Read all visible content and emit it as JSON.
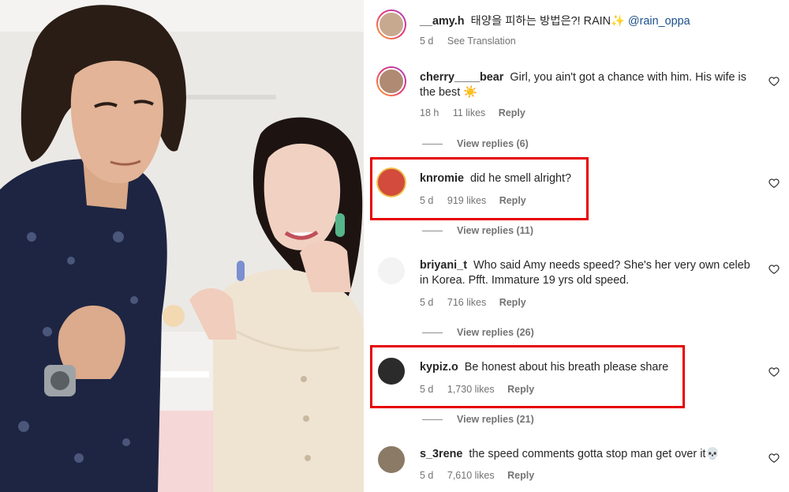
{
  "comments": [
    {
      "username": "__amy.h",
      "text": "태양을 피하는 방법은?! RAIN✨",
      "mention": "@rain_oppa",
      "time": "5 d",
      "action": "See Translation",
      "likes": "",
      "reply": ""
    },
    {
      "username": "cherry____bear",
      "text": "Girl, you ain't got a chance with him. His wife is the best ☀️",
      "time": "18 h",
      "likes": "11 likes",
      "reply": "Reply",
      "view_replies": "View replies (6)"
    },
    {
      "username": "knromie",
      "text": "did he smell alright?",
      "time": "5 d",
      "likes": "919 likes",
      "reply": "Reply",
      "view_replies": "View replies (11)"
    },
    {
      "username": "briyani_t",
      "text": "Who said Amy needs speed? She's her very own celeb in Korea. Pfft. Immature 19 yrs old speed.",
      "time": "5 d",
      "likes": "716 likes",
      "reply": "Reply",
      "view_replies": "View replies (26)"
    },
    {
      "username": "kypiz.o",
      "text": "Be honest about his breath please share",
      "time": "5 d",
      "likes": "1,730 likes",
      "reply": "Reply",
      "view_replies": "View replies (21)"
    },
    {
      "username": "s_3rene",
      "text": "the speed comments gotta stop man get over it💀",
      "time": "5 d",
      "likes": "7,610 likes",
      "reply": "Reply"
    }
  ],
  "colors": {
    "highlight": "#e60000",
    "mention": "#1a4f8b",
    "meta": "#737373",
    "story_ring": "#e8336d"
  },
  "icons": {
    "like": "heart-outline-icon"
  }
}
